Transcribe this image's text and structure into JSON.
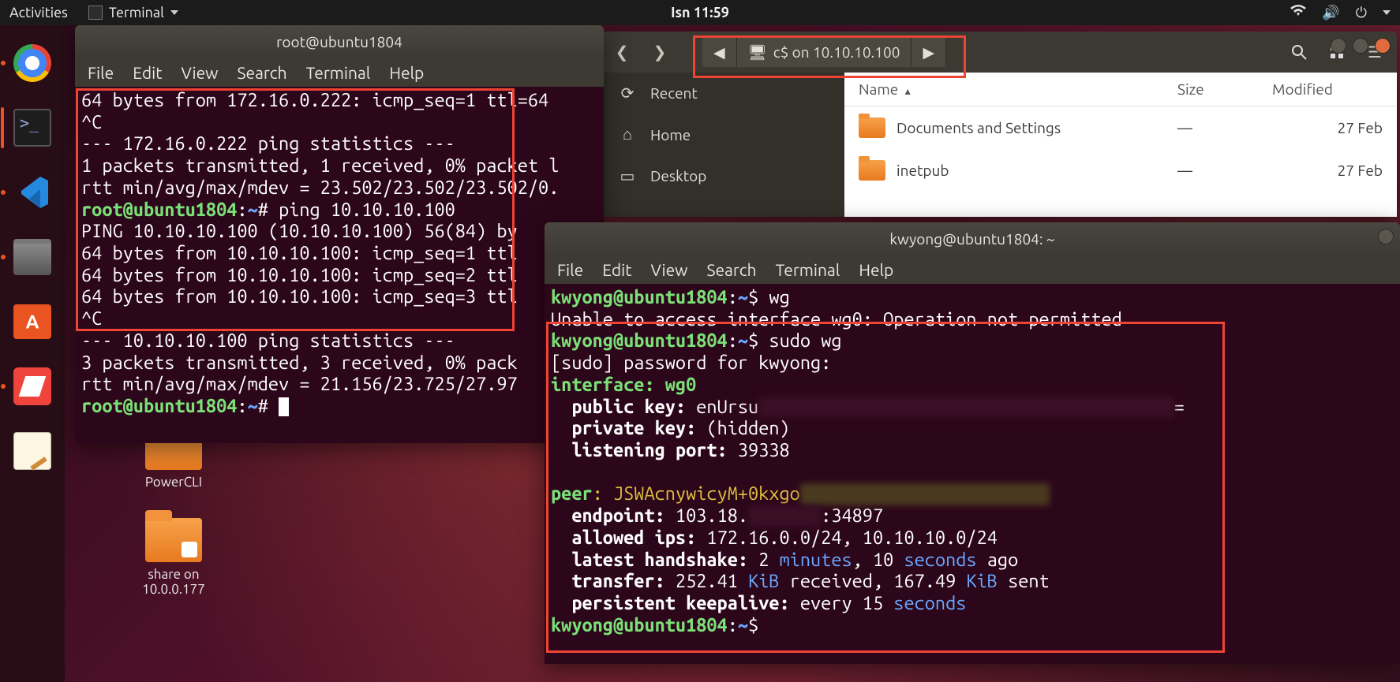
{
  "topbar": {
    "activities": "Activities",
    "app_name": "Terminal",
    "clock": "Isn 11:59"
  },
  "launcher": [
    {
      "name": "chrome",
      "active": false
    },
    {
      "name": "terminal",
      "active": true
    },
    {
      "name": "vscode",
      "active": false
    },
    {
      "name": "files",
      "active": false
    },
    {
      "name": "software",
      "active": false
    },
    {
      "name": "anydesk",
      "active": false
    },
    {
      "name": "textedit",
      "active": false
    }
  ],
  "desktop_icons": {
    "folder1": "PowerCLI",
    "folder2_line1": "share on",
    "folder2_line2": "10.0.0.177"
  },
  "terminal1": {
    "title": "root@ubuntu1804",
    "menu": [
      "File",
      "Edit",
      "View",
      "Search",
      "Terminal",
      "Help"
    ],
    "lines_raw": "64 bytes from 172.16.0.222: icmp_seq=1 ttl=64\n^C\n--- 172.16.0.222 ping statistics ---\n1 packets transmitted, 1 received, 0% packet l\nrtt min/avg/max/mdev = 23.502/23.502/23.502/0.",
    "prompt1_user": "root@ubuntu1804",
    "prompt1_path": "~",
    "prompt1_cmd": "ping 10.10.10.100",
    "lines2": "PING 10.10.10.100 (10.10.10.100) 56(84) by\n64 bytes from 10.10.10.100: icmp_seq=1 ttl\n64 bytes from 10.10.10.100: icmp_seq=2 ttl\n64 bytes from 10.10.10.100: icmp_seq=3 ttl\n^C\n--- 10.10.10.100 ping statistics ---\n3 packets transmitted, 3 received, 0% pack\nrtt min/avg/max/mdev = 21.156/23.725/27.97",
    "prompt2_user": "root@ubuntu1804",
    "prompt2_path": "~"
  },
  "files": {
    "path_label": "c$ on 10.10.10.100",
    "sidebar": [
      {
        "icon": "⟳",
        "label": "Recent"
      },
      {
        "icon": "⌂",
        "label": "Home"
      },
      {
        "icon": "▭",
        "label": "Desktop"
      }
    ],
    "columns": {
      "name": "Name",
      "size": "Size",
      "modified": "Modified"
    },
    "rows": [
      {
        "name": "Documents and Settings",
        "size": "—",
        "modified": "27 Feb"
      },
      {
        "name": "inetpub",
        "size": "—",
        "modified": "27 Feb"
      }
    ]
  },
  "terminal2": {
    "title": "kwyong@ubuntu1804: ~",
    "menu": [
      "File",
      "Edit",
      "View",
      "Search",
      "Terminal",
      "Help"
    ],
    "p1_user": "kwyong@ubuntu1804",
    "p1_path": "~",
    "p1_cmd": "wg",
    "err": "Unable to access interface wg0: Operation not permitted",
    "p2_user": "kwyong@ubuntu1804",
    "p2_path": "~",
    "p2_cmd": "sudo wg",
    "sudo": "[sudo] password for kwyong:",
    "iface_k": "interface",
    "iface_v": ": wg0",
    "pubk": "  public key:",
    "pubv": " enUrsu",
    "privk": "  private key:",
    "privv": " (hidden)",
    "portk": "  listening port:",
    "portv": " 39338",
    "peer_k": "peer",
    "peer_v": ": JSWAcnywicyM+0kxgo",
    "endk": "  endpoint:",
    "endv_a": " 103.18.",
    "endv_b": ":34897",
    "allowk": "  allowed ips:",
    "allowv": " 172.16.0.0/24, 10.10.10.0/24",
    "hsk": "  latest handshake:",
    "hs1": " 2 ",
    "hs_min": "minutes",
    "hs2": ", 10 ",
    "hs_sec": "seconds",
    "hs3": " ago",
    "trk": "  transfer:",
    "tr1": " 252.41 ",
    "tr_kib1": "KiB",
    "tr2": " received, 167.49 ",
    "tr_kib2": "KiB",
    "tr3": " sent",
    "pkk": "  persistent keepalive:",
    "pk1": " every 15 ",
    "pk_sec": "seconds",
    "p3_user": "kwyong@ubuntu1804",
    "p3_path": "~"
  }
}
